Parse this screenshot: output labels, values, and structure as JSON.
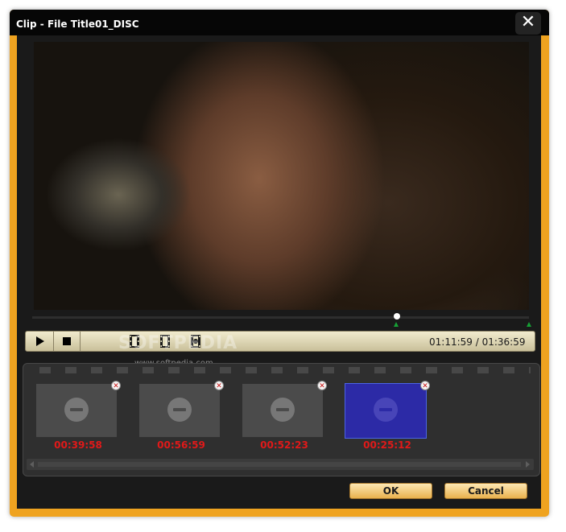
{
  "window": {
    "title": "Clip - File Title01_DISC",
    "close_glyph": "✕"
  },
  "player": {
    "time_display": "01:11:59 / 01:36:59",
    "playhead_fraction": 0.734,
    "buttons": [
      "play-icon",
      "stop-icon",
      "film-start-icon",
      "film-end-icon",
      "film-add-icon"
    ]
  },
  "watermark": {
    "text": "SOFTPEDIA",
    "url": "www.softpedia.com"
  },
  "clips": [
    {
      "time": "00:39:58",
      "selected": false
    },
    {
      "time": "00:56:59",
      "selected": false
    },
    {
      "time": "00:52:23",
      "selected": false
    },
    {
      "time": "00:25:12",
      "selected": true
    }
  ],
  "remove_glyph": "✕",
  "buttons": {
    "ok": "OK",
    "cancel": "Cancel"
  },
  "colors": {
    "frame": "#efa320",
    "clip_time": "#e11919",
    "selected_clip": "#2c2aa6"
  }
}
